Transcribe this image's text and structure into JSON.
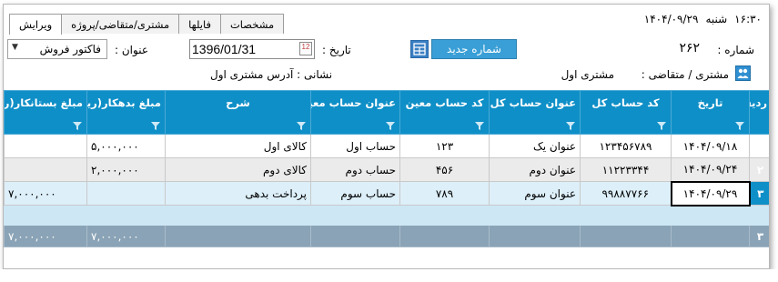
{
  "window": {
    "time": "۱۶:۳۰",
    "day": "شنبه",
    "date": "۱۴۰۴/۰۹/۲۹"
  },
  "tabs": [
    {
      "label": "ویرایش",
      "active": true
    },
    {
      "label": "مشتری/متقاضی/پروژه",
      "active": false
    },
    {
      "label": "فایلها",
      "active": false
    },
    {
      "label": "مشخصات",
      "active": false
    }
  ],
  "form": {
    "shomare_label": "شماره :",
    "shomare_value": "۲۶۲",
    "new_number_button": "شماره جدید",
    "tarikh_label": "تاریخ :",
    "tarikh_value": "1396/01/31",
    "calendar_text": "12",
    "onvan_label": "عنوان :",
    "onvan_value": "فاکتور فروش",
    "customer_label": "مشتری / متقاضی :",
    "customer_value": "مشتری اول",
    "address_label": "نشانی : آدرس مشتری اول"
  },
  "grid": {
    "headers": {
      "rownum": "ردیف",
      "date": "تاریخ",
      "account_code": "کد حساب کل",
      "account_title": "عنوان حساب کل",
      "sub_code": "کد حساب معین",
      "sub_title": "عنوان حساب معین",
      "desc": "شرح",
      "debit": "مبلغ بدهکار(ریال)",
      "credit": "مبلغ بستانکار(ریا"
    },
    "rows": [
      {
        "num": "۱",
        "date": "۱۴۰۴/۰۹/۱۸",
        "account_code": "۱۲۳۴۵۶۷۸۹",
        "account_title": "عنوان یک",
        "sub_code": "۱۲۳",
        "sub_title": "حساب اول",
        "desc": "کالای اول",
        "debit": "۵,۰۰۰,۰۰۰",
        "credit": ""
      },
      {
        "num": "۲",
        "date": "۱۴۰۴/۰۹/۲۴",
        "account_code": "۱۱۲۲۳۳۴۴",
        "account_title": "عنوان دوم",
        "sub_code": "۴۵۶",
        "sub_title": "حساب دوم",
        "desc": "کالای دوم",
        "debit": "۲,۰۰۰,۰۰۰",
        "credit": ""
      },
      {
        "num": "۳",
        "date": "۱۴۰۴/۰۹/۲۹",
        "account_code": "۹۹۸۸۷۷۶۶",
        "account_title": "عنوان سوم",
        "sub_code": "۷۸۹",
        "sub_title": "حساب سوم",
        "desc": "پرداخت بدهی",
        "debit": "",
        "credit": "۷,۰۰۰,۰۰۰"
      }
    ],
    "footer": {
      "count": "۳",
      "debit_total": "۷,۰۰۰,۰۰۰",
      "credit_total": "۷,۰۰۰,۰۰۰"
    }
  },
  "colors": {
    "header": "#0f8fc7",
    "button": "#3a9fd6",
    "footer": "#8aa3b6"
  }
}
